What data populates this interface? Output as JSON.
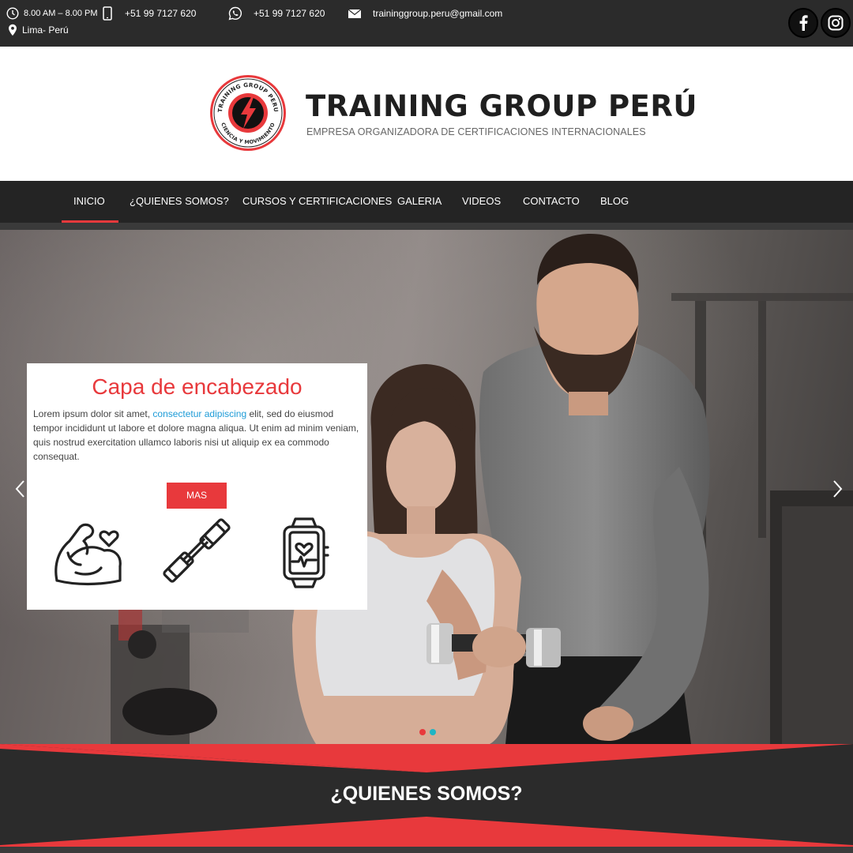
{
  "topbar": {
    "hours": "8.00 AM – 8.00 PM",
    "phone": "+51 99 7127 620",
    "whatsapp": "+51 99 7127 620",
    "email": "traininggroup.peru@gmail.com",
    "location": "Lima- Perú",
    "icons": [
      "clock-icon",
      "mobile-phone-icon",
      "whatsapp-icon",
      "envelope-icon",
      "map-pin-icon"
    ],
    "social": [
      "facebook-icon",
      "instagram-icon"
    ]
  },
  "header": {
    "brand": "TRAINING GROUP PERÚ",
    "tagline": "EMPRESA ORGANIZADORA DE CERTIFICACIONES INTERNACIONALES",
    "logo_ring_top": "TRAINING GROUP PERU",
    "logo_ring_bottom": "CIENCIA Y MOVIMIENTO"
  },
  "nav": {
    "items": [
      "INICIO",
      "¿QUIENES SOMOS?",
      "CURSOS Y CERTIFICACIONES",
      "GALERIA",
      "VIDEOS",
      "CONTACTO",
      "BLOG"
    ],
    "active": "INICIO"
  },
  "hero": {
    "title": "Capa de encabezado",
    "text_before": "Lorem ipsum dolor sit amet, ",
    "text_highlight": "consectetur adipiscing",
    "text_after": " elit, sed do eiusmod tempor incididunt ut labore et dolore magna aliqua. Ut enim ad minim veniam, quis nostrud exercitation ullamco laboris nisi ut aliquip ex ea commodo consequat.",
    "button": "MAS",
    "icons": [
      "flexed-arm-heart-icon",
      "dumbbell-icon",
      "smartwatch-heart-icon"
    ],
    "slides": 2,
    "active_slide": 1
  },
  "section": {
    "title": "¿QUIENES SOMOS?"
  },
  "colors": {
    "accent": "#e8393c",
    "dark": "#2b2b2b",
    "link": "#1d9bd7",
    "dot_active": "#1fb5c4"
  }
}
